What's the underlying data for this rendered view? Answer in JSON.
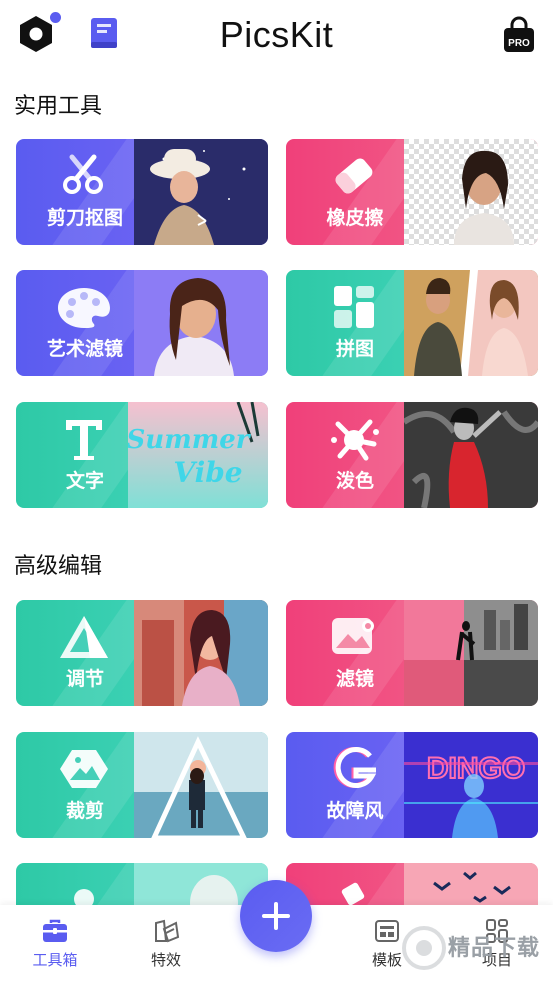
{
  "header": {
    "title": "PicsKit",
    "pro_label": "PRO",
    "accent": "#5a5cf0"
  },
  "sections": {
    "practical": "实用工具",
    "advanced": "高级编辑"
  },
  "tools": {
    "cutout": {
      "label": "剪刀抠图",
      "icon": "scissors-icon"
    },
    "eraser": {
      "label": "橡皮擦",
      "icon": "eraser-icon"
    },
    "art_filter": {
      "label": "艺术滤镜",
      "icon": "palette-icon"
    },
    "collage": {
      "label": "拼图",
      "icon": "collage-icon"
    },
    "text": {
      "label": "文字",
      "icon": "text-icon",
      "banner_line1": "Summer",
      "banner_line2": "Vibe"
    },
    "splash": {
      "label": "泼色",
      "icon": "splash-icon"
    },
    "adjust": {
      "label": "调节",
      "icon": "adjust-icon"
    },
    "filter": {
      "label": "滤镜",
      "icon": "filter-icon"
    },
    "crop": {
      "label": "裁剪",
      "icon": "crop-icon"
    },
    "glitch": {
      "label": "故障风",
      "icon": "glitch-icon",
      "banner": "DINGO"
    }
  },
  "nav": {
    "toolbox": "工具箱",
    "effects": "特效",
    "templates": "模板",
    "projects": "项目"
  },
  "watermark": "精品下载",
  "colors": {
    "purple": "#5a5cf0",
    "pink": "#f0407a",
    "teal": "#2ec9a6"
  }
}
